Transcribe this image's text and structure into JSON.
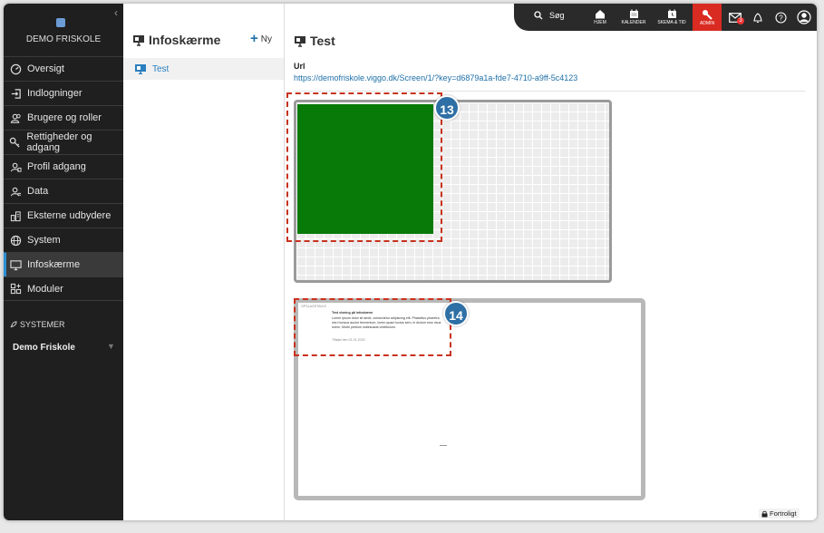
{
  "sidebar": {
    "school_name": "DEMO FRISKOLE",
    "items": [
      {
        "label": "Oversigt",
        "icon": "dashboard-icon"
      },
      {
        "label": "Indlogninger",
        "icon": "login-icon"
      },
      {
        "label": "Brugere og roller",
        "icon": "users-icon"
      },
      {
        "label": "Rettigheder og adgang",
        "icon": "key-icon"
      },
      {
        "label": "Profil adgang",
        "icon": "profile-access-icon"
      },
      {
        "label": "Data",
        "icon": "data-icon"
      },
      {
        "label": "Eksterne udbydere",
        "icon": "external-providers-icon"
      },
      {
        "label": "System",
        "icon": "globe-icon"
      },
      {
        "label": "Infoskærme",
        "icon": "monitor-icon"
      },
      {
        "label": "Moduler",
        "icon": "modules-icon"
      }
    ],
    "active_item": "Infoskærme",
    "systems_title": "SYSTEMER",
    "systems_school": "Demo Friskole"
  },
  "list": {
    "title": "Infoskærme",
    "new_label": "Ny",
    "rows": [
      {
        "label": "Test"
      }
    ]
  },
  "topbar": {
    "search_label": "Søg",
    "home_label": "HJEM",
    "calendar_label": "KALENDER",
    "schedule_label": "SKEMA & TID",
    "admin_label": "ADMIN",
    "messages_count": "3"
  },
  "main": {
    "title": "Test",
    "url_label": "Url",
    "url_value": "https://demofriskole.viggo.dk/Screen/1/?key=d6879a1a-fde7-4710-a9ff-5c4123"
  },
  "callouts": {
    "first": "13",
    "second": "14"
  },
  "preview_text": {
    "header": "OPSLAGSTAVLE",
    "heading": "Test visning på infoskærm",
    "body": "Lorem ipsum dolor sit amet, consectetur adipiscing elit. Phasellus pharetra, nisi rhoncus auctor fermentum, lorem quam luctus sem, in dictum eros risus lorem. Morbi pretium malesuada vestibulum.",
    "footer": "Tilføjet den 01.01.2020"
  },
  "footer": {
    "confidential_label": "Fortroligt"
  },
  "colors": {
    "sidebar_bg": "#1f1f1f",
    "admin_red": "#d92b22",
    "link_blue": "#1d6fa8",
    "preview_green": "#087a08",
    "callout_dash": "#c8321e",
    "callout_circle": "#2e6fa5"
  }
}
